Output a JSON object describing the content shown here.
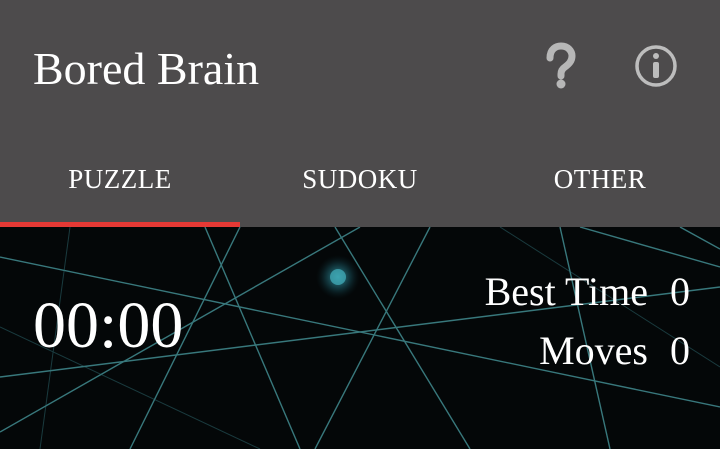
{
  "header": {
    "title": "Bored Brain",
    "help_icon": "help-icon",
    "info_icon": "info-icon"
  },
  "tabs": [
    {
      "label": "PUZZLE",
      "active": true
    },
    {
      "label": "SUDOKU",
      "active": false
    },
    {
      "label": "OTHER",
      "active": false
    }
  ],
  "game": {
    "timer": "00:00",
    "best_time_label": "Best Time",
    "best_time_value": "0",
    "moves_label": "Moves",
    "moves_value": "0"
  },
  "colors": {
    "appbar": "#4d4b4c",
    "tab_indicator": "#e53935",
    "background": "#040708",
    "network_lines": "#3f8f94"
  }
}
